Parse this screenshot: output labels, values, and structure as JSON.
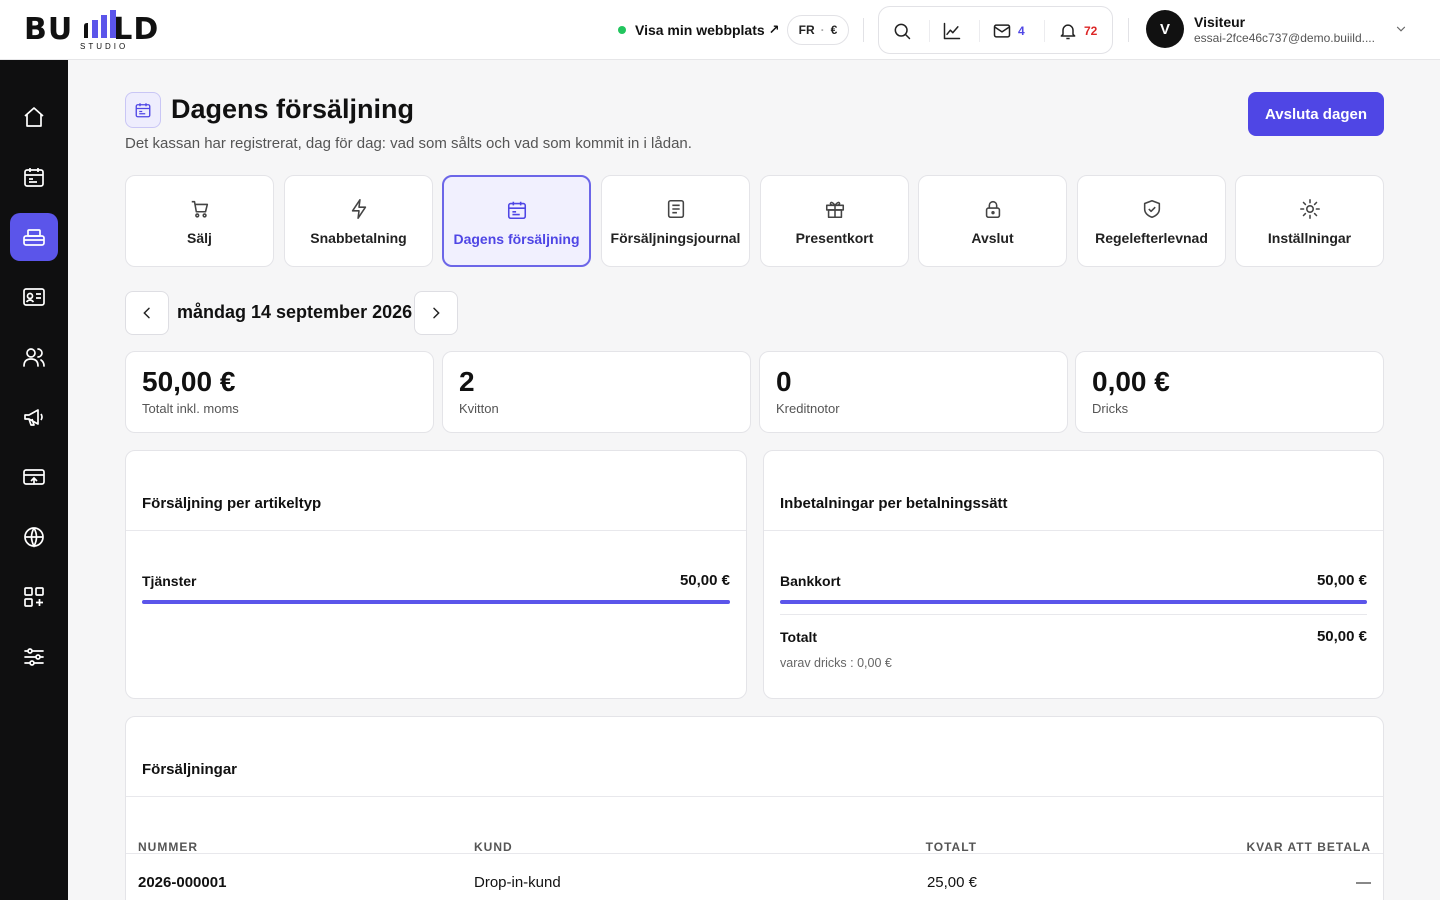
{
  "brand": {
    "logo_text": "BUILD",
    "logo_sub": "STUDIO"
  },
  "topbar": {
    "site_link": "Visa min webbplats",
    "site_link_arrow": "↗",
    "locale_lang": "FR",
    "locale_currency": "€",
    "mail_count": "4",
    "notif_count": "72",
    "colors": {
      "mail_count": "#4f46e5",
      "notif_count": "#dc2626",
      "online_dot": "#22c55e"
    }
  },
  "user": {
    "initial": "V",
    "name": "Visiteur",
    "email": "essai-2fce46c737@demo.buiild...."
  },
  "sidebar": {
    "items": [
      {
        "icon": "home-icon",
        "active": false
      },
      {
        "icon": "calendar-icon",
        "active": false
      },
      {
        "icon": "cash-register-icon",
        "active": true
      },
      {
        "icon": "contact-card-icon",
        "active": false
      },
      {
        "icon": "users-icon",
        "active": false
      },
      {
        "icon": "megaphone-icon",
        "active": false
      },
      {
        "icon": "payment-card-icon",
        "active": false
      },
      {
        "icon": "globe-icon",
        "active": false
      },
      {
        "icon": "apps-icon",
        "active": false
      },
      {
        "icon": "sliders-icon",
        "active": false
      }
    ]
  },
  "page": {
    "title": "Dagens försäljning",
    "subtitle": "Det kassan har registrerat, dag för dag: vad som sålts och vad som kommit in i lådan.",
    "primary_action": "Avsluta dagen",
    "accent": "#4f46e5"
  },
  "tiles": [
    {
      "label": "Sälj",
      "icon": "cart-icon"
    },
    {
      "label": "Snabbetalning",
      "icon": "lightning-icon"
    },
    {
      "label": "Dagens försäljning",
      "icon": "calendar-icon",
      "active": true
    },
    {
      "label": "Försäljningsjournal",
      "icon": "journal-icon"
    },
    {
      "label": "Presentkort",
      "icon": "gift-icon"
    },
    {
      "label": "Avslut",
      "icon": "lock-icon"
    },
    {
      "label": "Regelefterlevnad",
      "icon": "shield-check-icon"
    },
    {
      "label": "Inställningar",
      "icon": "sun-gear-icon"
    }
  ],
  "date_nav": {
    "label": "måndag 14 september 2026"
  },
  "stats": [
    {
      "value": "50,00 €",
      "label": "Totalt inkl. moms"
    },
    {
      "value": "2",
      "label": "Kvitton"
    },
    {
      "value": "0",
      "label": "Kreditnotor"
    },
    {
      "value": "0,00 €",
      "label": "Dricks"
    }
  ],
  "by_type": {
    "title": "Försäljning per artikeltyp",
    "rows": [
      {
        "label": "Tjänster",
        "value": "50,00 €",
        "share": 1.0
      }
    ]
  },
  "by_payment": {
    "title": "Inbetalningar per betalningssätt",
    "rows": [
      {
        "label": "Bankkort",
        "value": "50,00 €",
        "share": 1.0
      }
    ],
    "total_label": "Totalt",
    "total_value": "50,00 €",
    "tips_note": "varav dricks : 0,00 €"
  },
  "sales": {
    "title": "Försäljningar",
    "columns": [
      "NUMMER",
      "KUND",
      "TOTALT",
      "KVAR ATT BETALA"
    ],
    "rows": [
      {
        "number": "2026-000001",
        "customer": "Drop-in-kund",
        "total": "25,00 €",
        "remaining": "—"
      }
    ]
  }
}
